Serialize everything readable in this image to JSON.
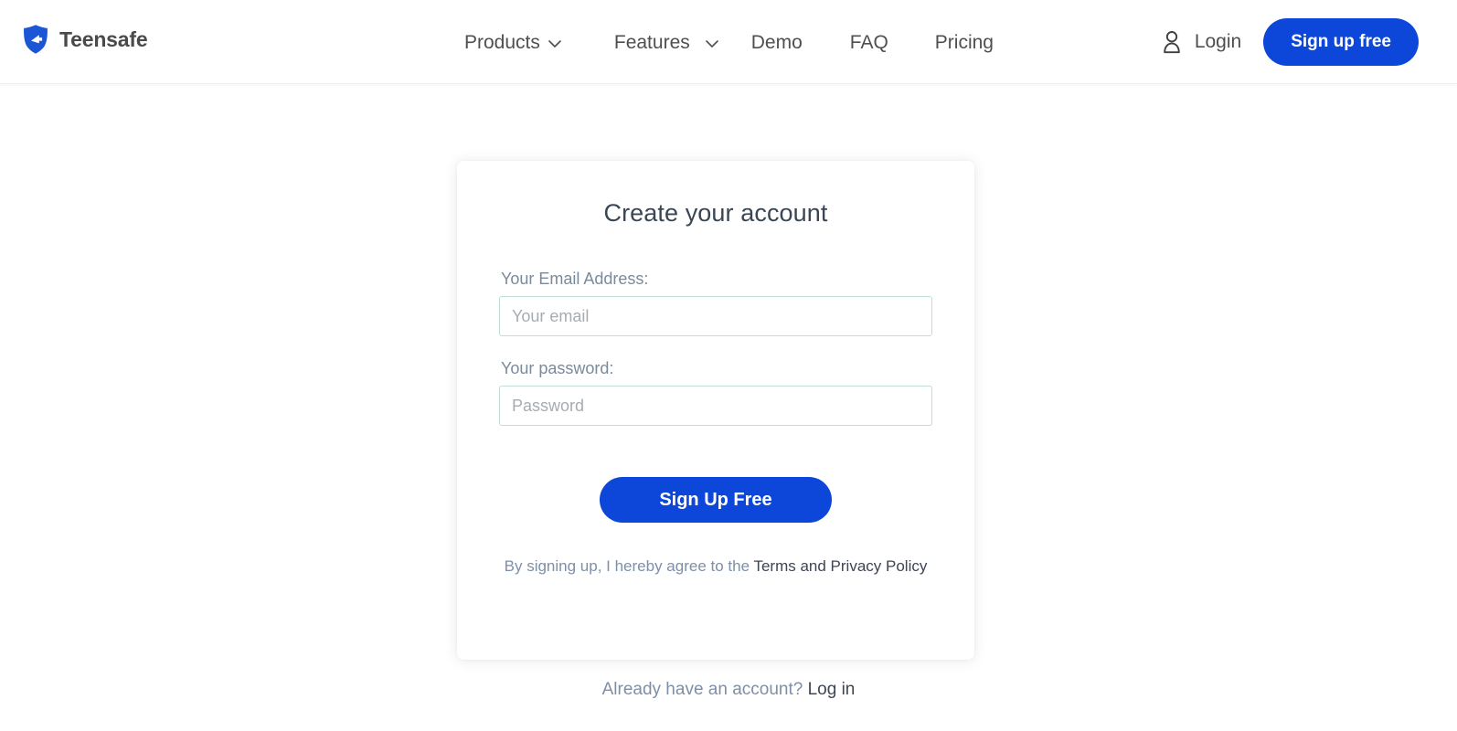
{
  "header": {
    "brand": {
      "name": "Teensafe",
      "logo_icon": "shield-icon",
      "logo_color": "#1a56d6"
    },
    "nav": [
      {
        "label": "Products",
        "icon": "chevron-down-icon",
        "has_dropdown": true
      },
      {
        "label": "Features",
        "icon": "chevron-down-icon",
        "has_dropdown": true
      },
      {
        "label": "Demo",
        "has_dropdown": false
      },
      {
        "label": "FAQ",
        "has_dropdown": false
      },
      {
        "label": "Pricing",
        "has_dropdown": false
      }
    ],
    "login": {
      "label": "Login",
      "icon": "user-icon"
    },
    "signup_button": {
      "label": "Sign up free",
      "color": "#0d47d9"
    }
  },
  "signup_card": {
    "title": "Create your account",
    "fields": [
      {
        "label": "Your Email Address:",
        "placeholder": "Your email",
        "value": "",
        "type": "email"
      },
      {
        "label": "Your password:",
        "placeholder": "Password",
        "value": "",
        "type": "password"
      }
    ],
    "submit_button": {
      "label": "Sign Up Free",
      "color": "#0d47d9"
    },
    "terms": {
      "prefix": "By signing up, I hereby agree to the ",
      "link": "Terms and Privacy Policy"
    }
  },
  "footer_prompt": {
    "text": "Already have an account? ",
    "link": "Log in"
  },
  "colors": {
    "accent": "#0d47d9",
    "input_border": "#bfdfd3",
    "muted_text": "#7e8fa6",
    "body_text": "#3d4653",
    "background": "#ffffff"
  }
}
